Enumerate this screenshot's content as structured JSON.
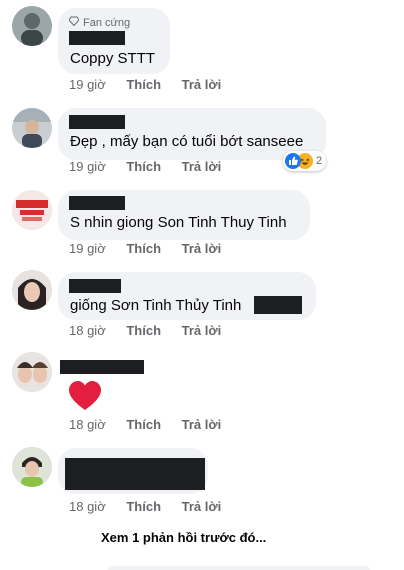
{
  "badge": {
    "label": "Fan cứng"
  },
  "comments": [
    {
      "text": "Coppy STTT",
      "time": "19 giờ",
      "like": "Thích",
      "reply": "Trả lời"
    },
    {
      "text": "Đẹp , mấy bạn có tuổi bớt sanseee",
      "time": "19 giờ",
      "like": "Thích",
      "reply": "Trả lời",
      "reactions": {
        "count": "2",
        "icons": [
          "like-icon",
          "haha-icon"
        ]
      }
    },
    {
      "text": "S nhin giong Son Tinh Thuy Tinh",
      "time": "19 giờ",
      "like": "Thích",
      "reply": "Trả lời"
    },
    {
      "text": "giống Sơn Tinh Thủy Tinh",
      "time": "18 giờ",
      "like": "Thích",
      "reply": "Trả lời"
    },
    {
      "text": "",
      "emoji": "heart",
      "time": "18 giờ",
      "like": "Thích",
      "reply": "Trả lời"
    },
    {
      "text": "",
      "time": "18 giờ",
      "like": "Thích",
      "reply": "Trả lời"
    }
  ],
  "view_more": "Xem 1 phản hồi trước đó...",
  "colors": {
    "bubble": "#f0f2f5",
    "meta": "#65676b",
    "like": "#1877f2",
    "heart": "#e41e3f",
    "redaction": "#1c1e21"
  }
}
